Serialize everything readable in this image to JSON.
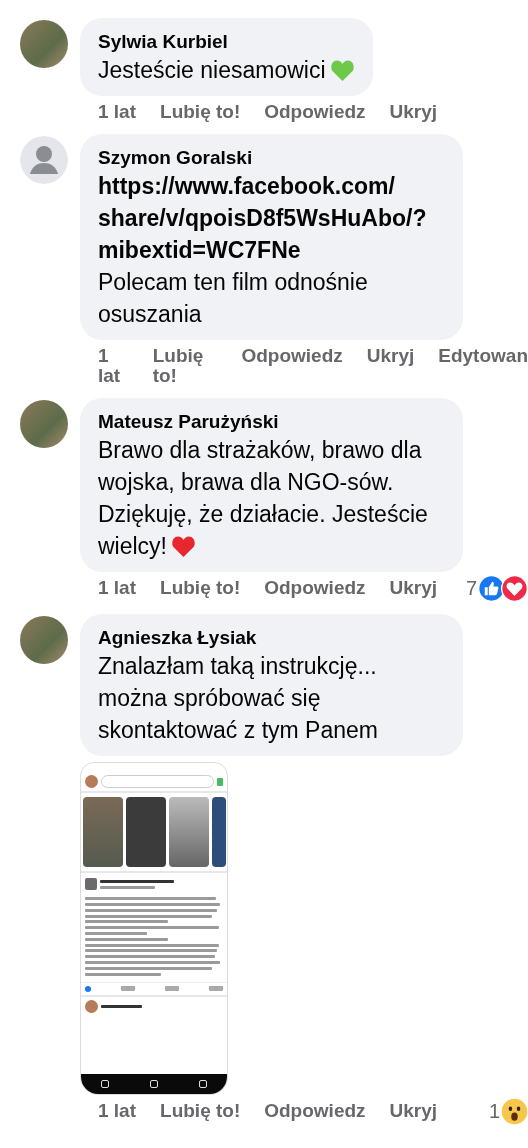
{
  "comments": [
    {
      "author": "Sylwia Kurbiel",
      "avatar": {
        "kind": "photo"
      },
      "text": "Jesteście niesamowici",
      "emoji": {
        "kind": "heart",
        "color": "#6cc94a"
      },
      "actions": {
        "time": "1 lat",
        "like": "Lubię to!",
        "reply": "Odpowiedz",
        "hide": "Ukryj"
      }
    },
    {
      "author": "Szymon Goralski",
      "avatar": {
        "kind": "default"
      },
      "link": "https://www.facebook.com/share/v/qpoisD8f5WsHuAbo/?mibextid=WC7FNe",
      "text": "Polecam ten film odnośnie osuszania",
      "actions": {
        "time": "1 lat",
        "like": "Lubię to!",
        "reply": "Odpowiedz",
        "hide": "Ukryj",
        "edited": "Edytowan"
      }
    },
    {
      "author": "Mateusz Parużyński",
      "avatar": {
        "kind": "photo"
      },
      "text": "Brawo dla strażaków, brawo dla wojska, brawa dla NGO-sów. Dziękuję, że działacie. Jesteście wielcy!",
      "emoji": {
        "kind": "heart",
        "color": "#e8262d"
      },
      "actions": {
        "time": "1 lat",
        "like": "Lubię to!",
        "reply": "Odpowiedz",
        "hide": "Ukryj"
      },
      "reactions": {
        "count": "7",
        "types": [
          {
            "kind": "like"
          },
          {
            "kind": "love"
          }
        ]
      }
    },
    {
      "author": "Agnieszka Łysiak",
      "avatar": {
        "kind": "photo"
      },
      "text": "Znalazłam taką instrukcję... można spróbować się skontaktować z tym Panem",
      "attachment": {
        "kind": "screenshot"
      },
      "actions": {
        "time": "1 lat",
        "like": "Lubię to!",
        "reply": "Odpowiedz",
        "hide": "Ukryj"
      },
      "reactions": {
        "count": "1",
        "types": [
          {
            "kind": "wow"
          }
        ]
      }
    }
  ]
}
